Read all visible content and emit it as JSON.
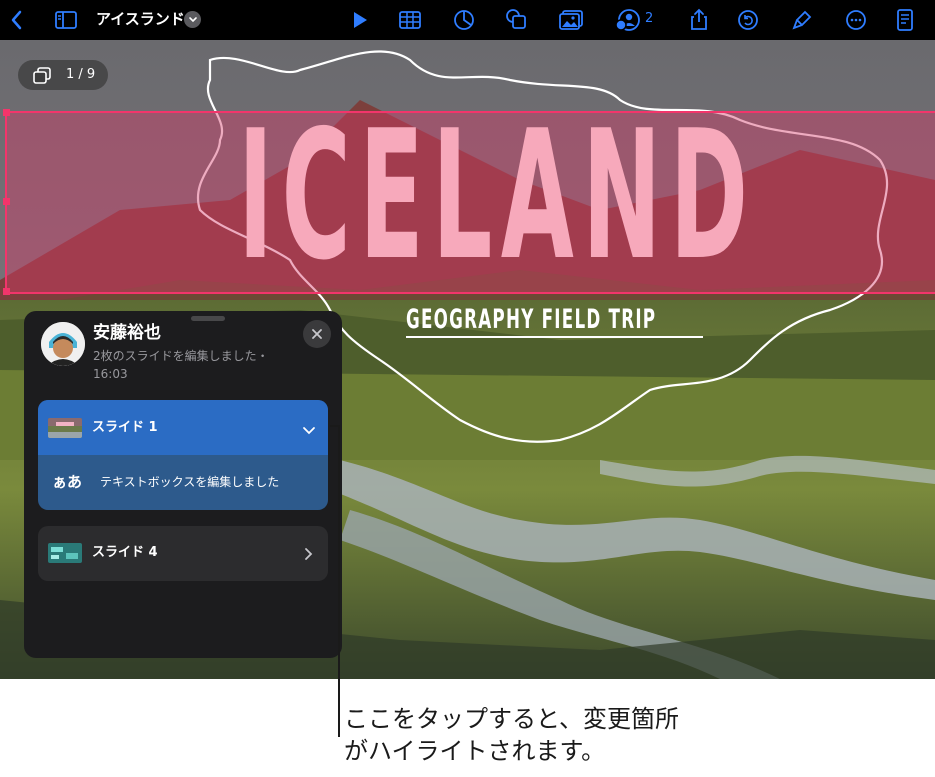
{
  "toolbar": {
    "title": "アイスランド",
    "collaborator_count": "2",
    "accent_color": "#2f7dff"
  },
  "canvas": {
    "slide_counter": "1 / 9",
    "title_text": "ICELAND",
    "subtitle_text": "GEOGRAPHY FIELD TRIP",
    "highlight_color": "#f2356b"
  },
  "activity_panel": {
    "user_name": "安藤裕也",
    "activity_summary": "2枚のスライドを編集しました・16:03",
    "slides": [
      {
        "label": "スライド 1",
        "expanded": true,
        "changes": [
          {
            "icon_text": "ぁあ",
            "description": "テキストボックスを編集しました"
          }
        ]
      },
      {
        "label": "スライド 4",
        "expanded": false
      }
    ]
  },
  "callout": {
    "line1": "ここをタップすると、変更箇所",
    "line2": "がハイライトされます。"
  }
}
